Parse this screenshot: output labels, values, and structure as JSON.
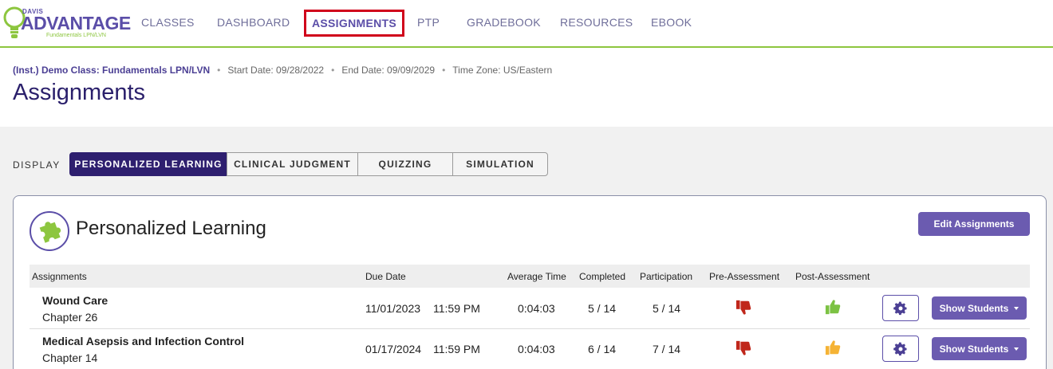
{
  "brand": {
    "davis": "DAVIS",
    "advantage": "ADVANTAGE",
    "subtitle": "Fundamentals LPN/LVN"
  },
  "nav": [
    {
      "label": "CLASSES"
    },
    {
      "label": "DASHBOARD"
    },
    {
      "label": "ASSIGNMENTS",
      "active": true
    },
    {
      "label": "PTP"
    },
    {
      "label": "GRADEBOOK"
    },
    {
      "label": "RESOURCES"
    },
    {
      "label": "EBOOK"
    }
  ],
  "header": {
    "class_name": "(Inst.) Demo Class: Fundamentals LPN/LVN",
    "start_date": "Start Date: 09/28/2022",
    "end_date": "End Date: 09/09/2029",
    "time_zone": "Time Zone: US/Eastern",
    "title": "Assignments"
  },
  "display": {
    "label": "DISPLAY",
    "options": [
      {
        "label": "PERSONALIZED LEARNING",
        "active": true
      },
      {
        "label": "CLINICAL JUDGMENT"
      },
      {
        "label": "QUIZZING"
      },
      {
        "label": "SIMULATION"
      }
    ]
  },
  "card": {
    "title": "Personalized Learning",
    "edit_button": "Edit Assignments",
    "icon": "puzzle-piece-icon",
    "columns": [
      "Assignments",
      "Due Date",
      "Average Time",
      "Completed",
      "Participation",
      "Pre-Assessment",
      "Post-Assessment"
    ],
    "rows": [
      {
        "name": "Wound Care",
        "chapter": "Chapter 26",
        "due_date": "11/01/2023",
        "due_time": "11:59 PM",
        "avg_time": "0:04:03",
        "completed": "5 / 14",
        "participation": "5 / 14",
        "pre_assessment": "thumbs-down-icon",
        "post_assessment": "thumbs-up-icon",
        "show_button": "Show Students"
      },
      {
        "name": "Medical Asepsis and Infection Control",
        "chapter": "Chapter 14",
        "due_date": "01/17/2024",
        "due_time": "11:59 PM",
        "avg_time": "0:04:03",
        "completed": "6 / 14",
        "participation": "7 / 14",
        "pre_assessment": "thumbs-down-icon",
        "post_assessment": "thumbs-up-icon",
        "show_button": "Show Students"
      }
    ]
  },
  "colors": {
    "accent": "#5b4ea8",
    "navy": "#2e1f6f",
    "green": "#8dc63f",
    "thumb_down": "#c0271b",
    "thumb_up_good": "#7cc243",
    "thumb_up_mid": "#f5b335"
  }
}
